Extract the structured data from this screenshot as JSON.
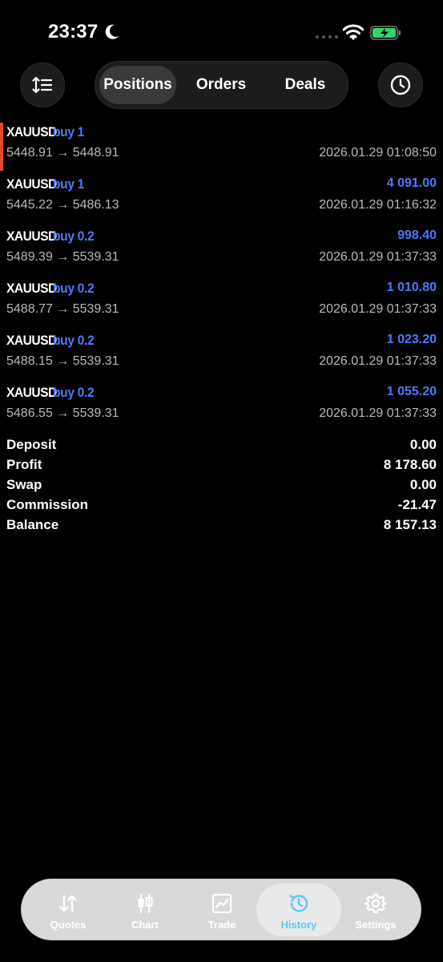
{
  "status_bar": {
    "time": "23:37"
  },
  "header": {
    "segments": [
      {
        "label": "Positions",
        "active": true
      },
      {
        "label": "Orders",
        "active": false
      },
      {
        "label": "Deals",
        "active": false
      }
    ]
  },
  "trades": [
    {
      "symbol": "XAUUSD",
      "side": "buy 1",
      "profit": "",
      "prices": "5448.91 → 5448.91",
      "time": "2026.01.29 01:08:50"
    },
    {
      "symbol": "XAUUSD",
      "side": "buy 1",
      "profit": "4 091.00",
      "prices": "5445.22 → 5486.13",
      "time": "2026.01.29 01:16:32"
    },
    {
      "symbol": "XAUUSD",
      "side": "buy 0.2",
      "profit": "998.40",
      "prices": "5489.39 → 5539.31",
      "time": "2026.01.29 01:37:33"
    },
    {
      "symbol": "XAUUSD",
      "side": "buy 0.2",
      "profit": "1 010.80",
      "prices": "5488.77 → 5539.31",
      "time": "2026.01.29 01:37:33"
    },
    {
      "symbol": "XAUUSD",
      "side": "buy 0.2",
      "profit": "1 023.20",
      "prices": "5488.15 → 5539.31",
      "time": "2026.01.29 01:37:33"
    },
    {
      "symbol": "XAUUSD",
      "side": "buy 0.2",
      "profit": "1 055.20",
      "prices": "5486.55 → 5539.31",
      "time": "2026.01.29 01:37:33"
    }
  ],
  "summary": [
    {
      "label": "Deposit",
      "value": "0.00"
    },
    {
      "label": "Profit",
      "value": "8 178.60"
    },
    {
      "label": "Swap",
      "value": "0.00"
    },
    {
      "label": "Commission",
      "value": "-21.47"
    },
    {
      "label": "Balance",
      "value": "8 157.13"
    }
  ],
  "tabbar": {
    "tabs": [
      {
        "label": "Quotes",
        "icon": "quotes-icon"
      },
      {
        "label": "Chart",
        "icon": "candlestick-icon"
      },
      {
        "label": "Trade",
        "icon": "trade-chart-icon"
      },
      {
        "label": "History",
        "icon": "history-icon",
        "active": true
      },
      {
        "label": "Settings",
        "icon": "gear-icon"
      }
    ]
  },
  "colors": {
    "accent_blue": "#4a7cf7",
    "marker_red": "#e34a33",
    "active_tab": "#5ac8fa"
  }
}
